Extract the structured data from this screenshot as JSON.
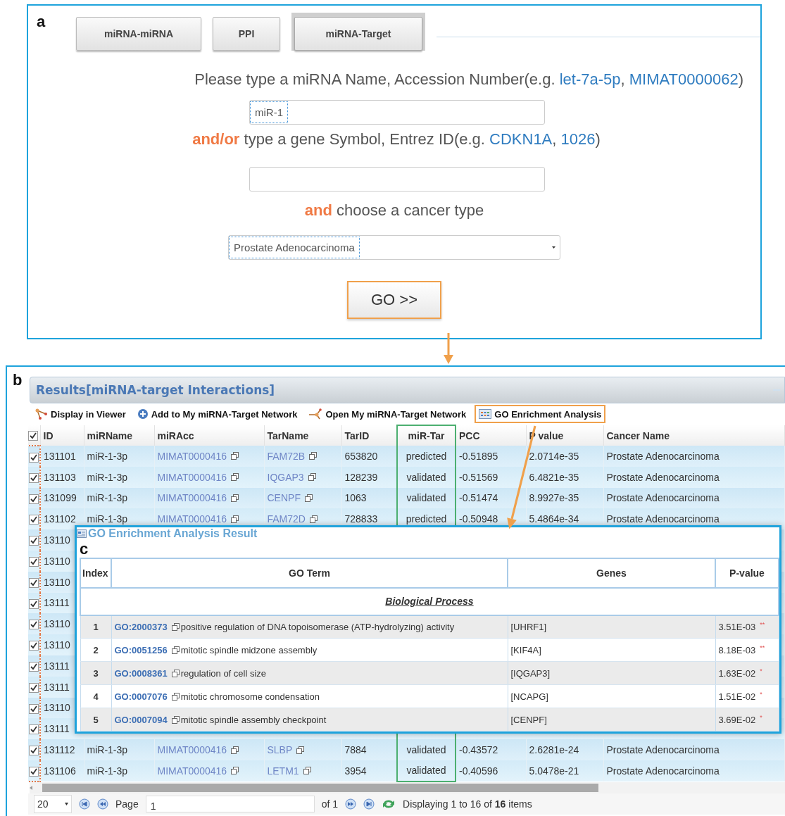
{
  "panel_labels": [
    "a",
    "b",
    "c"
  ],
  "search": {
    "tabs": [
      {
        "label": "miRNA-miRNA",
        "selected": false
      },
      {
        "label": "PPI",
        "selected": false
      },
      {
        "label": "miRNA-Target",
        "selected": true
      }
    ],
    "form": [
      {
        "kind": "prompt",
        "segments": [
          {
            "kind": "text",
            "text": "Please type a miRNA Name, Accession Number(e.g. "
          },
          {
            "kind": "link",
            "text": "let-7a-5p"
          },
          {
            "kind": "text",
            "text": ", "
          },
          {
            "kind": "link",
            "text": "MIMAT0000062"
          },
          {
            "kind": "text",
            "text": ")"
          }
        ]
      },
      {
        "kind": "field",
        "value": "miR-1"
      },
      {
        "kind": "prompt",
        "segments": [
          {
            "kind": "emphasis",
            "text": "and/or"
          },
          {
            "kind": "text",
            "text": " type a gene Symbol, Entrez ID(e.g. "
          },
          {
            "kind": "link",
            "text": "CDKN1A"
          },
          {
            "kind": "text",
            "text": ", "
          },
          {
            "kind": "link",
            "text": "1026"
          },
          {
            "kind": "text",
            "text": ")"
          }
        ]
      },
      {
        "kind": "field"
      },
      {
        "kind": "prompt",
        "segments": [
          {
            "kind": "emphasis",
            "text": "and"
          },
          {
            "kind": "text",
            "text": " choose a cancer type"
          }
        ]
      },
      {
        "kind": "select",
        "value": "Prostate Adenocarcinoma"
      },
      {
        "kind": "button",
        "label": "GO >>"
      }
    ]
  },
  "results": {
    "title": "Results[miRNA-target Interactions]",
    "toolbar": [
      {
        "kind": "viewer",
        "label": "Display in Viewer"
      },
      {
        "kind": "add",
        "label": "Add to My miRNA-Target Network"
      },
      {
        "kind": "open",
        "label": "Open My miRNA-Target Network"
      },
      {
        "kind": "go",
        "label": "GO Enrichment Analysis"
      }
    ],
    "all_checked": true,
    "columns": [
      "ID",
      "miRName",
      "miRAcc",
      "TarName",
      "TarID",
      "miR-Tar",
      "PCC",
      "P value",
      "Cancer Name"
    ],
    "rows": [
      {
        "checked": true,
        "id": "131101",
        "mirna": "miR-1-3p",
        "acc": "MIMAT0000416",
        "target": "FAM72B",
        "tar_id": "653820",
        "type": "predicted",
        "pcc": "-0.51895",
        "p": "2.0714e-35",
        "cancer": "Prostate Adenocarcinoma"
      },
      {
        "checked": true,
        "id": "131103",
        "mirna": "miR-1-3p",
        "acc": "MIMAT0000416",
        "target": "IQGAP3",
        "tar_id": "128239",
        "type": "validated",
        "pcc": "-0.51569",
        "p": "6.4821e-35",
        "cancer": "Prostate Adenocarcinoma"
      },
      {
        "checked": true,
        "id": "131099",
        "mirna": "miR-1-3p",
        "acc": "MIMAT0000416",
        "target": "CENPF",
        "tar_id": "1063",
        "type": "validated",
        "pcc": "-0.51474",
        "p": "8.9927e-35",
        "cancer": "Prostate Adenocarcinoma"
      },
      {
        "checked": true,
        "id": "131102",
        "mirna": "miR-1-3p",
        "acc": "MIMAT0000416",
        "target": "FAM72D",
        "tar_id": "728833",
        "type": "predicted",
        "pcc": "-0.50948",
        "p": "5.4864e-34",
        "cancer": "Prostate Adenocarcinoma"
      },
      {
        "checked": true,
        "id": "13110"
      },
      {
        "checked": true,
        "id": "13110"
      },
      {
        "checked": true,
        "id": "13110"
      },
      {
        "checked": true,
        "id": "13111"
      },
      {
        "checked": true,
        "id": "13110"
      },
      {
        "checked": true,
        "id": "13110"
      },
      {
        "checked": true,
        "id": "13111"
      },
      {
        "checked": true,
        "id": "13111"
      },
      {
        "checked": true,
        "id": "13110"
      },
      {
        "checked": true,
        "id": "13111"
      },
      {
        "checked": true,
        "id": "131112",
        "mirna": "miR-1-3p",
        "acc": "MIMAT0000416",
        "target": "SLBP",
        "tar_id": "7884",
        "type": "validated",
        "pcc": "-0.43572",
        "p": "2.6281e-24",
        "cancer": "Prostate Adenocarcinoma"
      },
      {
        "checked": true,
        "id": "131106",
        "mirna": "miR-1-3p",
        "acc": "MIMAT0000416",
        "target": "LETM1",
        "tar_id": "3954",
        "type": "validated",
        "pcc": "-0.40596",
        "p": "5.0478e-21",
        "cancer": "Prostate Adenocarcinoma"
      }
    ],
    "pager": {
      "page_size": "20",
      "page_label": "Page",
      "page": "1",
      "of": "of 1",
      "summary": "Displaying 1 to 16 of **16** items"
    }
  },
  "go_result": {
    "title": "GO Enrichment Analysis Result",
    "columns": [
      "Index",
      "GO Term",
      "Genes",
      "P-value"
    ],
    "category": "Biological Process",
    "rows": [
      {
        "index": "1",
        "go_id": "GO:2000373",
        "term": "positive regulation of DNA topoisomerase (ATP-hydrolyzing) activity",
        "genes": "[UHRF1]",
        "p": "3.51E-03",
        "mark": "**"
      },
      {
        "index": "2",
        "go_id": "GO:0051256",
        "term": "mitotic spindle midzone assembly",
        "genes": "[KIF4A]",
        "p": "8.18E-03",
        "mark": "**"
      },
      {
        "index": "3",
        "go_id": "GO:0008361",
        "term": "regulation of cell size",
        "genes": "[IQGAP3]",
        "p": "1.63E-02",
        "mark": "*"
      },
      {
        "index": "4",
        "go_id": "GO:0007076",
        "term": "mitotic chromosome condensation",
        "genes": "[NCAPG]",
        "p": "1.51E-02",
        "mark": "*"
      },
      {
        "index": "5",
        "go_id": "GO:0007094",
        "term": "mitotic spindle assembly checkpoint",
        "genes": "[CENPF]",
        "p": "3.69E-02",
        "mark": "*"
      }
    ]
  }
}
